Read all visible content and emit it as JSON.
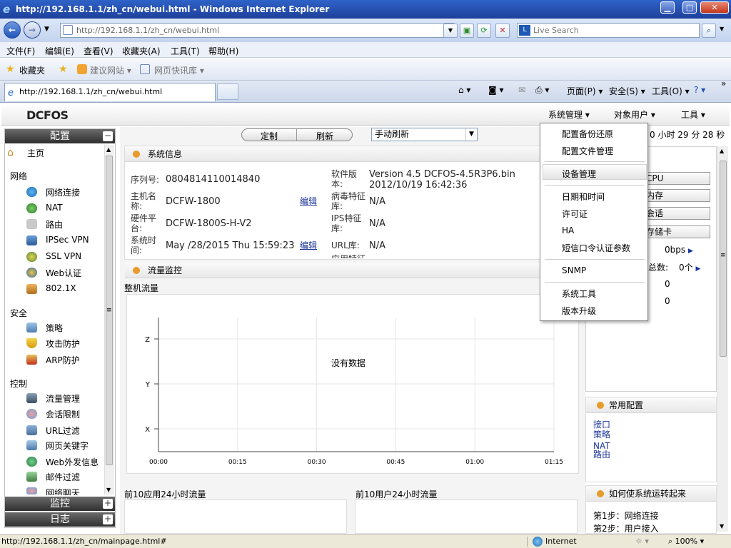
{
  "window": {
    "title": "http://192.168.1.1/zh_cn/webui.html - Windows Internet Explorer",
    "min": "▁",
    "max": "□",
    "close": "✕"
  },
  "address": {
    "url": "http://192.168.1.1/zh_cn/webui.html",
    "search_placeholder": "Live Search"
  },
  "menu": [
    "文件(F)",
    "编辑(E)",
    "查看(V)",
    "收藏夹(A)",
    "工具(T)",
    "帮助(H)"
  ],
  "favorites": {
    "fav": "收藏夹",
    "suggest": "建议网站 ▾",
    "slices": "网页快讯库 ▾"
  },
  "tab": {
    "label": "http://192.168.1.1/zh_cn/webui.html"
  },
  "commandbar": {
    "page": "页面(P) ▾",
    "safety": "安全(S) ▾",
    "tools": "工具(O) ▾",
    "chevron": "»"
  },
  "app": {
    "logo": "DCFOS",
    "topmenu": [
      "系统管理 ▾",
      "对象用户 ▾",
      "工具 ▾"
    ],
    "uptime": "0 小时 29 分 28 秒"
  },
  "sidebar": {
    "header": "配置",
    "home": "主页",
    "groups": [
      {
        "title": "网络",
        "items": [
          "网络连接",
          "NAT",
          "路由",
          "IPSec VPN",
          "SSL VPN",
          "Web认证",
          "802.1X"
        ]
      },
      {
        "title": "安全",
        "items": [
          "策略",
          "攻击防护",
          "ARP防护"
        ]
      },
      {
        "title": "控制",
        "items": [
          "流量管理",
          "会话限制",
          "URL过滤",
          "网页关键字",
          "Web外发信息",
          "邮件过滤",
          "网络聊天"
        ]
      }
    ],
    "monitor": "监控",
    "log": "日志",
    "toggle": "−",
    "expand": "+"
  },
  "toolbar": {
    "custom": "定制",
    "refresh": "刷新",
    "refresh_mode": "手动刷新"
  },
  "sysinfo": {
    "title": "系统信息",
    "serial_label": "序列号:",
    "serial": "0804814110014840",
    "host_label": "主机名称:",
    "host": "DCFW-1800",
    "hw_label": "硬件平台:",
    "hw": "DCFW-1800S-H-V2",
    "time_label": "系统时间:",
    "time": "May /28/2015  Thu  15:59:23",
    "sw_label": "软件版本:",
    "sw": "Version 4.5 DCFOS-4.5R3P6.bin 2012/10/19 16:42:36",
    "virus_label": "病毒特征库:",
    "virus": "N/A",
    "ips_label": "IPS特征库:",
    "ips": "N/A",
    "url_label": "URL库:",
    "url": "N/A",
    "edit": "编辑",
    "cut_text": "应用特征"
  },
  "traffic": {
    "title": "流量监控",
    "sub": "整机流量",
    "nodata": "没有数据",
    "top_apps": "前10应用24小时流量",
    "top_users": "前10用户24小时流量"
  },
  "chart_data": {
    "type": "line",
    "x": [
      "00:00",
      "00:15",
      "00:30",
      "00:45",
      "01:00",
      "01:15"
    ],
    "y_ticks": [
      "X",
      "Y",
      "Z"
    ],
    "series": [],
    "annotation": "没有数据"
  },
  "dropdown": {
    "items": [
      "配置备份还原",
      "配置文件管理",
      "设备管理",
      "日期和时间",
      "许可证",
      "HA",
      "短信口令认证参数",
      "SNMP",
      "系统工具",
      "版本升级"
    ]
  },
  "right": {
    "buttons": [
      "CPU",
      "内存",
      "会话",
      "存储卡"
    ],
    "bps": "0bps",
    "total_label": "总数:",
    "total": "0个",
    "v1": "0",
    "v2": "0",
    "common_title": "常用配置",
    "common_links": [
      "接口",
      "策略",
      "NAT",
      "路由"
    ],
    "howto_title": "如何使系统运转起来",
    "steps": [
      "第1步：网络连接",
      "第2步：用户接入"
    ]
  },
  "status": {
    "url": "http://192.168.1.1/zh_cn/mainpage.html#",
    "zone": "Internet",
    "zoom": "100%"
  }
}
